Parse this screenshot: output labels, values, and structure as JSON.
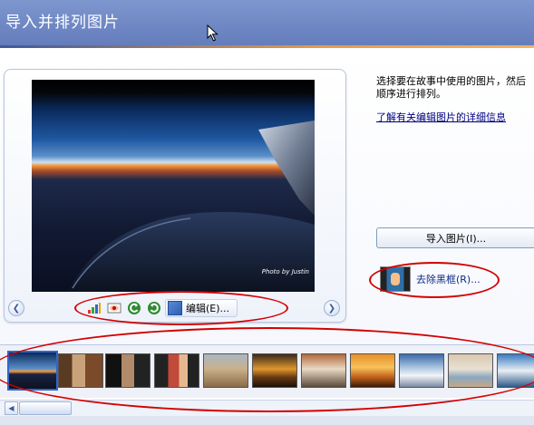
{
  "window": {
    "title": "导入并排列图片"
  },
  "instructions": {
    "description_line1": "选择要在故事中使用的图片，然后",
    "description_line2": "顺序进行排列。",
    "help_link": "了解有关编辑图片的详细信息"
  },
  "preview": {
    "photo_credit": "Photo by Justin"
  },
  "toolbar": {
    "icons": [
      "color-levels-icon",
      "red-eye-icon",
      "rotate-left-icon",
      "rotate-right-icon",
      "edit-icon"
    ],
    "edit_label": "编辑(E)..."
  },
  "actions": {
    "import_label": "导入图片(I)...",
    "remove_borders_label": "去除黑框(R)..."
  },
  "filmstrip": {
    "selected_index": 0,
    "thumbnails": [
      "airplane-sunset",
      "people-1",
      "people-2",
      "people-3",
      "desert",
      "sunset-1",
      "village",
      "sunset-2",
      "ocean-snow",
      "sea-landscape",
      "boat"
    ]
  },
  "colors": {
    "header": "#6e87c4",
    "accent": "#e79a4a",
    "annotation": "#d40000",
    "link": "#000080"
  }
}
